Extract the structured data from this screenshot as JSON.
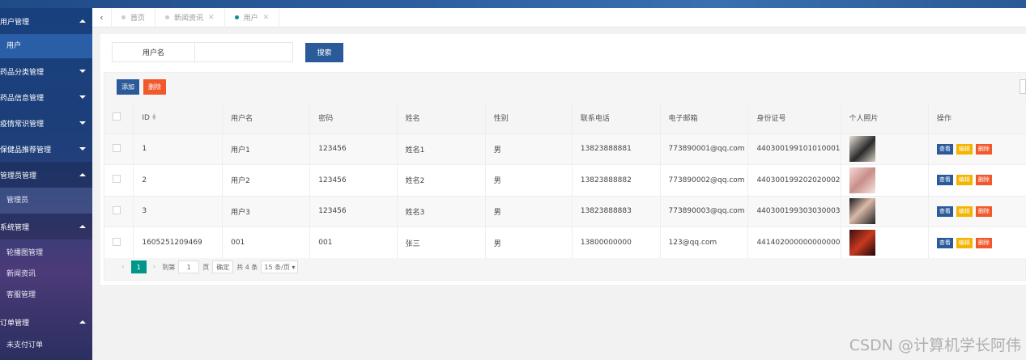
{
  "sidebar": {
    "groups": [
      {
        "label": "用户管理",
        "expanded": true,
        "items": [
          {
            "label": "用户",
            "selected": true
          }
        ]
      },
      {
        "label": "药品分类管理",
        "expanded": false,
        "items": []
      },
      {
        "label": "药品信息管理",
        "expanded": false,
        "items": []
      },
      {
        "label": "疫情常识管理",
        "expanded": false,
        "items": []
      },
      {
        "label": "保健品推荐管理",
        "expanded": false,
        "items": []
      },
      {
        "label": "管理员管理",
        "expanded": true,
        "items": [
          {
            "label": "管理员",
            "selected": false
          }
        ]
      },
      {
        "label": "系统管理",
        "expanded": true,
        "items": [
          {
            "label": "轮播图管理"
          },
          {
            "label": "新闻资讯"
          },
          {
            "label": "客服管理"
          }
        ]
      },
      {
        "label": "订单管理",
        "expanded": true,
        "items": [
          {
            "label": "未支付订单"
          }
        ]
      }
    ]
  },
  "tabs": [
    {
      "label": "首页",
      "closable": false,
      "active": false
    },
    {
      "label": "新闻资讯",
      "closable": true,
      "active": false
    },
    {
      "label": "用户",
      "closable": true,
      "active": true
    }
  ],
  "search": {
    "label": "用户名",
    "value": "",
    "button": "搜索"
  },
  "toolbar": {
    "add": "添加",
    "delete": "删除"
  },
  "table": {
    "columns": [
      "ID",
      "用户名",
      "密码",
      "姓名",
      "性别",
      "联系电话",
      "电子邮箱",
      "身份证号",
      "个人照片",
      "操作"
    ],
    "rows": [
      {
        "id": "1",
        "username": "用户1",
        "password": "123456",
        "name": "姓名1",
        "gender": "男",
        "phone": "13823888881",
        "email": "773890001@qq.com",
        "idcard": "440300199101010001"
      },
      {
        "id": "2",
        "username": "用户2",
        "password": "123456",
        "name": "姓名2",
        "gender": "男",
        "phone": "13823888882",
        "email": "773890002@qq.com",
        "idcard": "440300199202020002"
      },
      {
        "id": "3",
        "username": "用户3",
        "password": "123456",
        "name": "姓名3",
        "gender": "男",
        "phone": "13823888883",
        "email": "773890003@qq.com",
        "idcard": "440300199303030003"
      },
      {
        "id": "1605251209469",
        "username": "001",
        "password": "001",
        "name": "张三",
        "gender": "男",
        "phone": "13800000000",
        "email": "123@qq.com",
        "idcard": "441402000000000000"
      }
    ],
    "actions": {
      "view": "查看",
      "edit": "编辑",
      "delete": "删除"
    }
  },
  "pager": {
    "prev": "‹",
    "current": "1",
    "next": "›",
    "goto": "到第",
    "page_value": "1",
    "page_unit": "页",
    "confirm": "确定",
    "total": "共 4 条",
    "page_size": "15 条/页"
  },
  "watermark": "CSDN @计算机学长阿伟",
  "colors": {
    "primary": "#2a5a9a",
    "danger": "#f1582b",
    "warning": "#f4b400",
    "active": "#009688"
  }
}
